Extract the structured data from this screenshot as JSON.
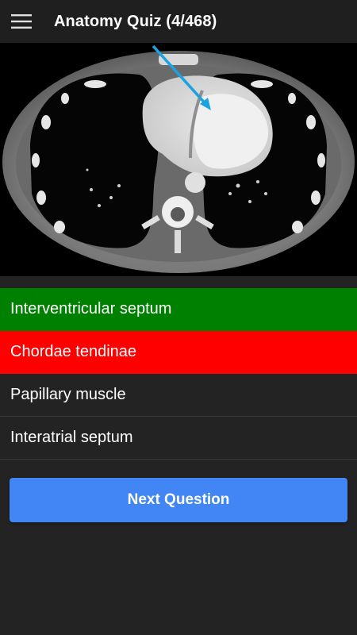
{
  "header": {
    "title": "Anatomy Quiz (4/468)",
    "menu_icon": "hamburger-menu-icon"
  },
  "image": {
    "description_icon": "ct-chest-axial-image",
    "pointer_color": "#1aa3e0"
  },
  "answers": [
    {
      "label": "Interventricular septum",
      "state": "correct",
      "color": "#008000"
    },
    {
      "label": "Chordae tendinae",
      "state": "wrong",
      "color": "#ff0000"
    },
    {
      "label": "Papillary muscle",
      "state": "neutral"
    },
    {
      "label": "Interatrial septum",
      "state": "neutral"
    }
  ],
  "next_button": {
    "label": "Next Question",
    "color": "#4285f4"
  }
}
